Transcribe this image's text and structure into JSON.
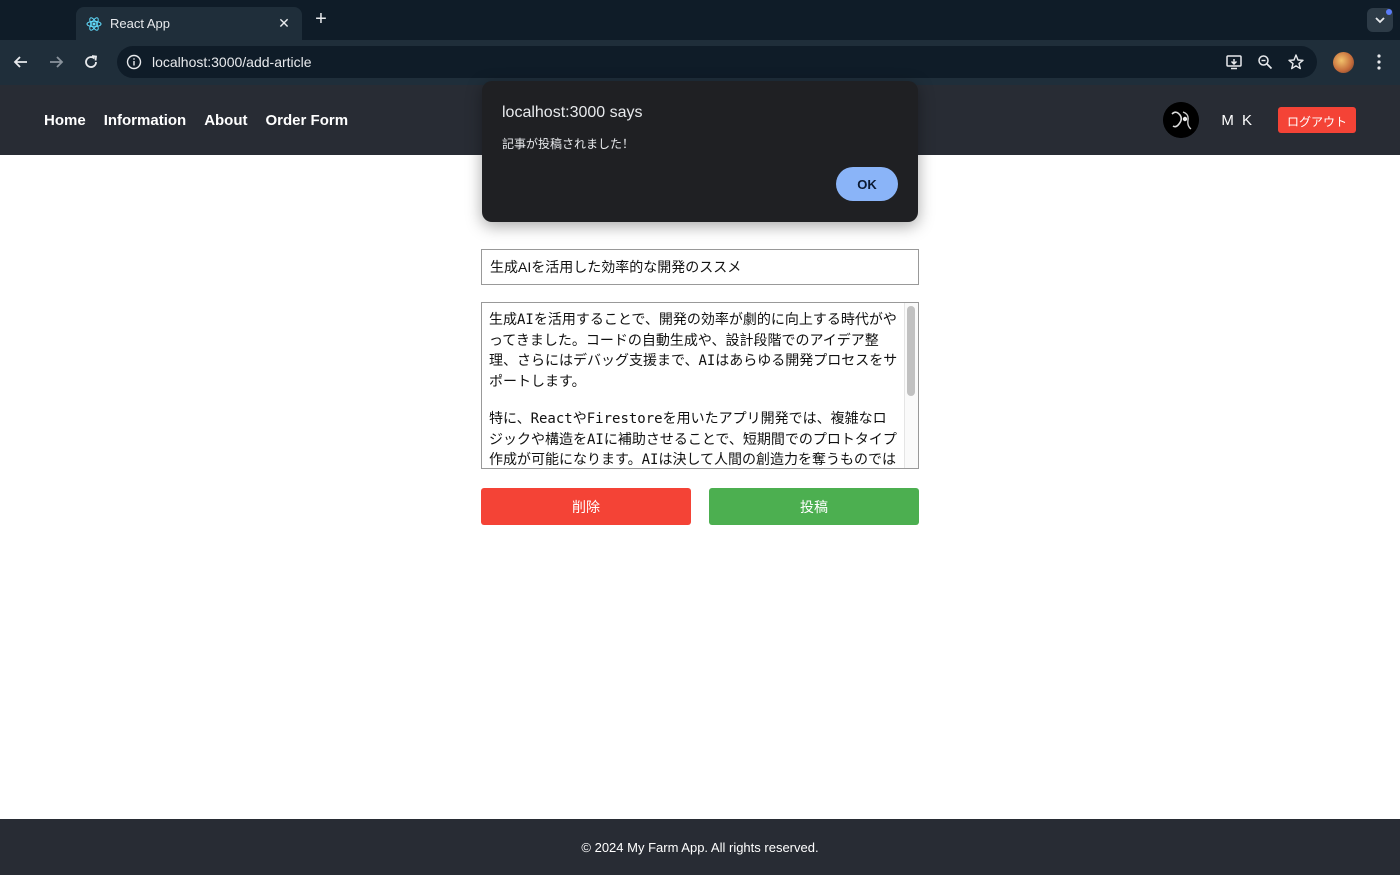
{
  "browser": {
    "tab_title": "React App",
    "tab_close": "✕",
    "new_tab": "+",
    "url": "localhost:3000/add-article"
  },
  "nav": {
    "links": [
      "Home",
      "Information",
      "About",
      "Order Form"
    ]
  },
  "user": {
    "name": "M K",
    "logout_label": "ログアウト"
  },
  "form": {
    "title_value": "生成AIを活用した効率的な開発のススメ",
    "content_paragraphs": [
      "生成AIを活用することで、開発の効率が劇的に向上する時代がやってきました。コードの自動生成や、設計段階でのアイデア整理、さらにはデバッグ支援まで、AIはあらゆる開発プロセスをサポートします。",
      "特に、ReactやFirestoreを用いたアプリ開発では、複雑なロジックや構造をAIに補助させることで、短期間でのプロトタイプ作成が可能になります。AIは決して人間の創造力を奪うものでは"
    ],
    "delete_label": "削除",
    "post_label": "投稿"
  },
  "footer": {
    "text": "© 2024 My Farm App. All rights reserved."
  },
  "dialog": {
    "title": "localhost:3000 says",
    "message": "記事が投稿されました！",
    "ok_label": "OK"
  },
  "colors": {
    "header_bg": "#282c34",
    "danger": "#f44336",
    "success": "#4caf50",
    "dialog_ok": "#8ab4f8"
  },
  "icons": [
    "react-favicon-icon",
    "back-arrow-icon",
    "forward-arrow-icon",
    "reload-icon",
    "site-info-icon",
    "install-app-icon",
    "zoom-icon",
    "bookmark-star-icon",
    "more-menu-icon",
    "tab-search-icon"
  ]
}
